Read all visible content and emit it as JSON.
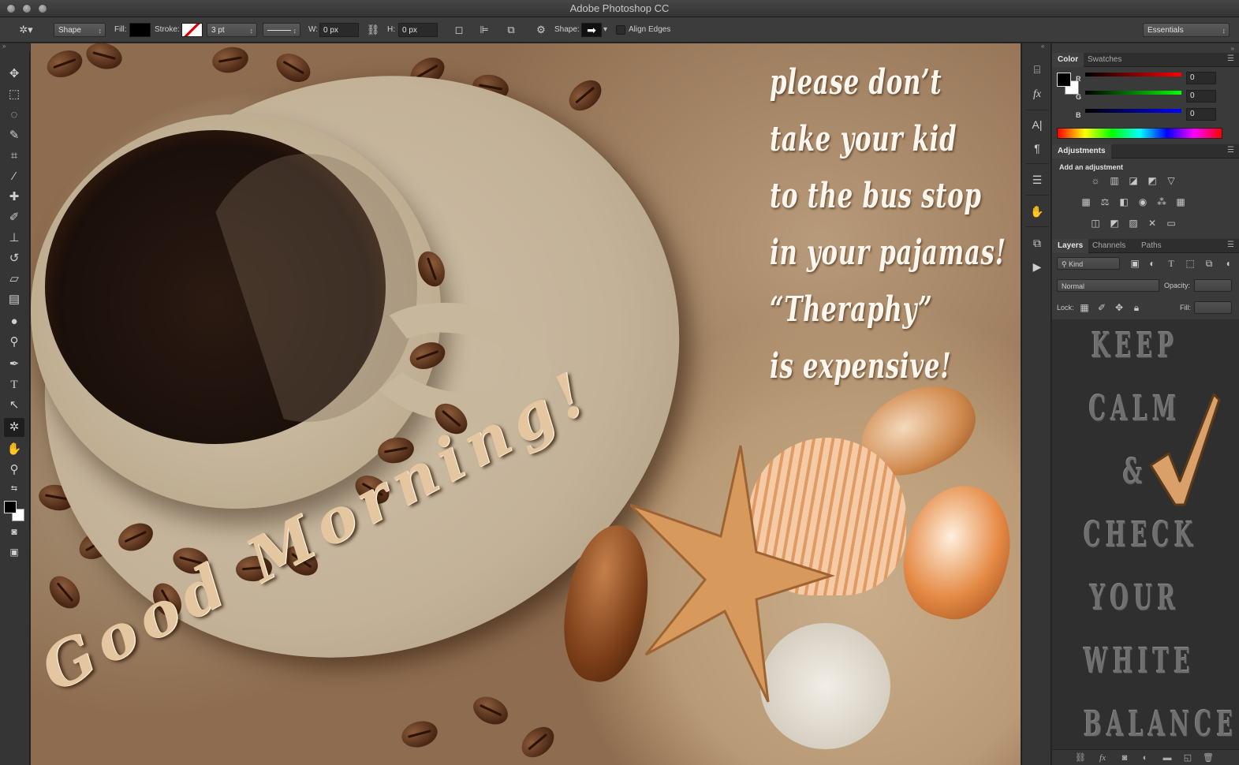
{
  "window": {
    "title": "Adobe Photoshop CC"
  },
  "options": {
    "mode": "Shape",
    "fill_label": "Fill:",
    "fill_color": "#000000",
    "stroke_label": "Stroke:",
    "stroke_width": "3 pt",
    "w_label": "W:",
    "w_value": "0 px",
    "h_label": "H:",
    "h_value": "0 px",
    "shape_label": "Shape:",
    "align_edges": "Align Edges",
    "workspace": "Essentials"
  },
  "canvas": {
    "quote": [
      "please don’t",
      "take your kid",
      "to the bus stop",
      "in your pajamas!",
      "“Theraphy”",
      "is expensive!"
    ],
    "greeting": "Good Morning!"
  },
  "color_panel": {
    "tabs": [
      "Color",
      "Swatches"
    ],
    "r_label": "R",
    "g_label": "G",
    "b_label": "B",
    "r_value": "0",
    "g_value": "0",
    "b_value": "0"
  },
  "adjustments_panel": {
    "tab": "Adjustments",
    "subtitle": "Add an adjustment"
  },
  "layers_panel": {
    "tabs": [
      "Layers",
      "Channels",
      "Paths"
    ],
    "filter": "Kind",
    "blend_mode": "Normal",
    "opacity_label": "Opacity:",
    "lock_label": "Lock:",
    "fill_label": "Fill:",
    "preview_lines": [
      "KEEP",
      "CALM",
      "&",
      "CHECK",
      "YOUR",
      "WHITE",
      "BALANCE"
    ]
  },
  "colors": {
    "accent_check": "#d9a06a",
    "panel_bg": "#3a3a3a"
  }
}
